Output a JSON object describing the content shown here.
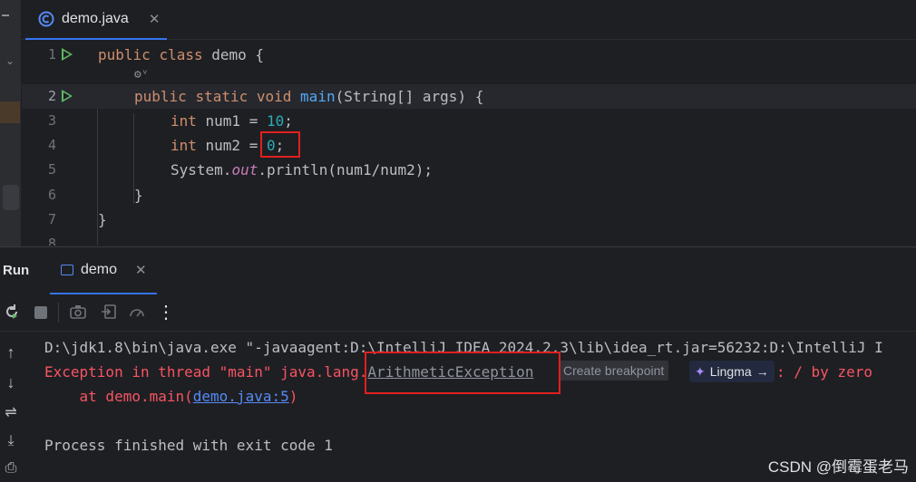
{
  "tab": {
    "label": "demo.java",
    "close": "✕"
  },
  "code": {
    "lines": [
      {
        "n": "1",
        "parts": [
          [
            "kw",
            "public "
          ],
          [
            "kw",
            "class "
          ],
          [
            "txt",
            "demo {"
          ]
        ]
      },
      {
        "n": "2",
        "parts": [
          [
            "kw",
            "public "
          ],
          [
            "kw",
            "static "
          ],
          [
            "kw",
            "void "
          ],
          [
            "fn",
            "main"
          ],
          [
            "txt",
            "(String[] args) {"
          ]
        ]
      },
      {
        "n": "3",
        "parts": [
          [
            "kw",
            "int "
          ],
          [
            "txt",
            "num1 = "
          ],
          [
            "num",
            "10"
          ],
          [
            "txt",
            ";"
          ]
        ]
      },
      {
        "n": "4",
        "parts": [
          [
            "kw",
            "int "
          ],
          [
            "txt",
            "num2 = "
          ],
          [
            "num",
            "0"
          ],
          [
            "txt",
            ";"
          ]
        ]
      },
      {
        "n": "5",
        "parts": [
          [
            "txt",
            "System."
          ],
          [
            "st",
            "out"
          ],
          [
            "txt",
            ".println(num1/num2);"
          ]
        ]
      },
      {
        "n": "6",
        "parts": [
          [
            "txt",
            "}"
          ]
        ]
      },
      {
        "n": "7",
        "parts": [
          [
            "txt",
            "}"
          ]
        ]
      },
      {
        "n": "8",
        "parts": []
      }
    ],
    "inlay": "⚙ᵛ"
  },
  "run": {
    "panel_label": "Run",
    "tab_label": "demo",
    "close": "✕"
  },
  "console": {
    "line1": "D:\\jdk1.8\\bin\\java.exe \"-javaagent:D:\\IntelliJ IDEA 2024.2.3\\lib\\idea_rt.jar=56232:D:\\IntelliJ I",
    "line2_prefix": "Exception in thread \"main\" java.lang.",
    "line2_exception": "ArithmeticException",
    "line2_suffix": ": / by zero",
    "create_breakpoint": "Create breakpoint",
    "lingma": "Lingma",
    "lingma_arrow": "→",
    "line3_prefix": "    at demo.main(",
    "line3_link": "demo.java:5",
    "line3_suffix": ")",
    "line5": "Process finished with exit code 1"
  },
  "watermark": "CSDN @倒霉蛋老马",
  "colors": {
    "accent": "#3574f0",
    "error": "#f75464",
    "highlight_box": "#e02020"
  }
}
